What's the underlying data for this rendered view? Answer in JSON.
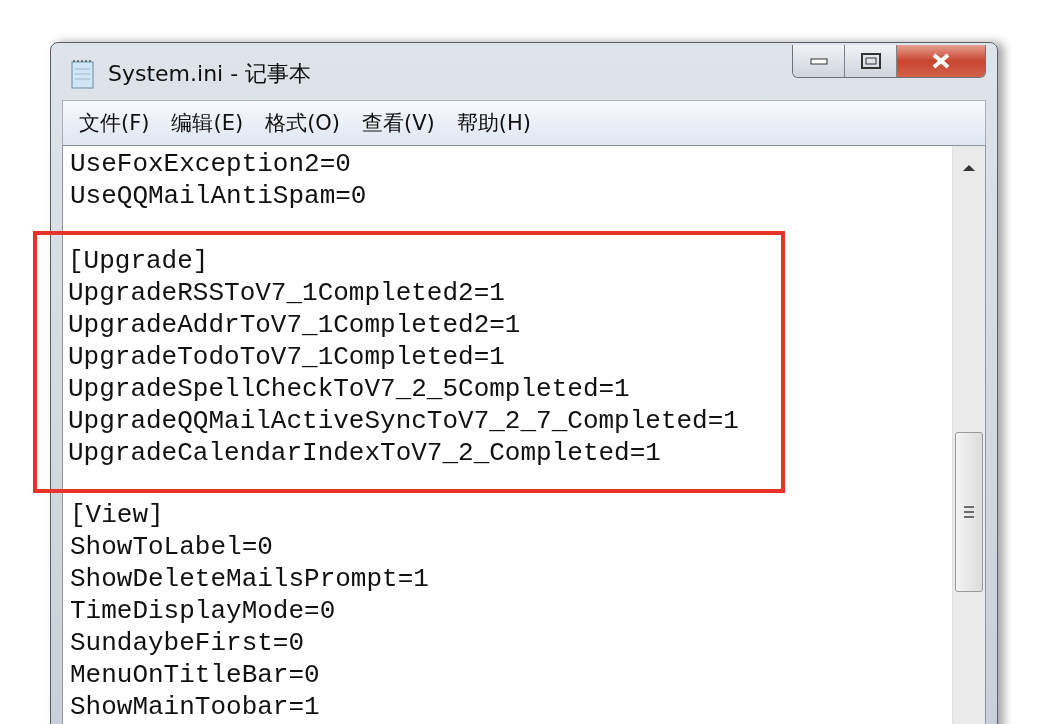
{
  "window": {
    "title": "System.ini - 记事本"
  },
  "menu": [
    "文件(F)",
    "编辑(E)",
    "格式(O)",
    "查看(V)",
    "帮助(H)"
  ],
  "sections": [
    {
      "highlighted": false,
      "lines": [
        "UseFoxException2=0",
        "UseQQMailAntiSpam=0"
      ]
    },
    {
      "highlighted": true,
      "lines": [
        "[Upgrade]",
        "UpgradeRSSToV7_1Completed2=1",
        "UpgradeAddrToV7_1Completed2=1",
        "UpgradeTodoToV7_1Completed=1",
        "UpgradeSpellCheckToV7_2_5Completed=1",
        "UpgradeQQMailActiveSyncToV7_2_7_Completed=1",
        "UpgradeCalendarIndexToV7_2_Completed=1"
      ]
    },
    {
      "highlighted": false,
      "lines": [
        "[View]",
        "ShowToLabel=0",
        "ShowDeleteMailsPrompt=1",
        "TimeDisplayMode=0",
        "SundaybeFirst=0",
        "MenuOnTitleBar=0",
        "ShowMainToobar=1"
      ]
    }
  ]
}
